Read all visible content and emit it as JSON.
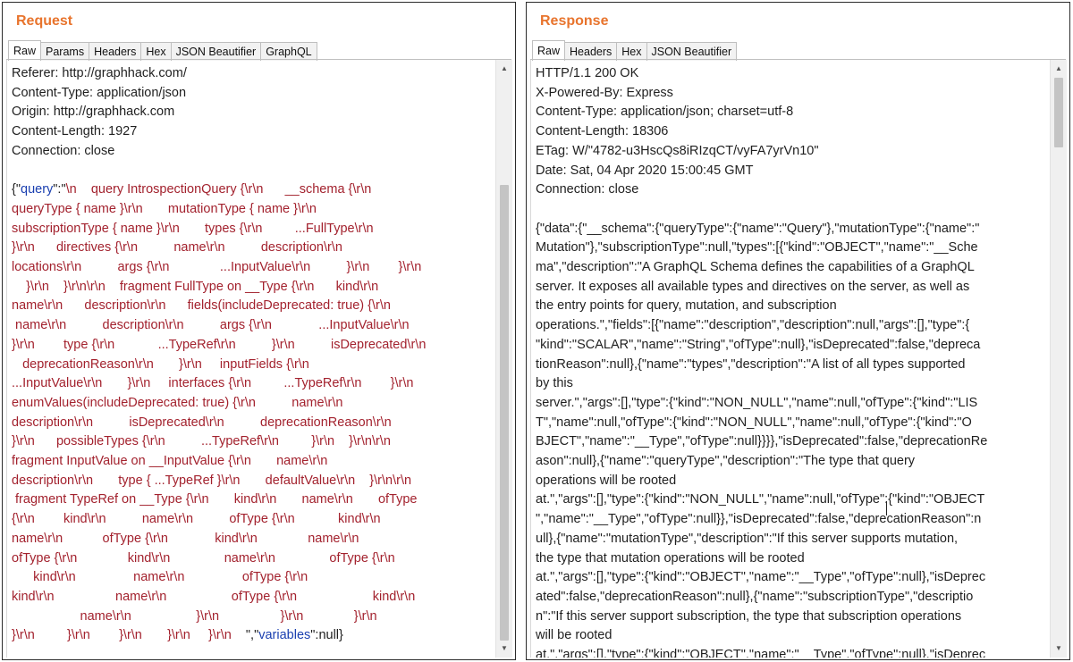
{
  "request": {
    "title": "Request",
    "tabs": [
      "Raw",
      "Params",
      "Headers",
      "Hex",
      "JSON Beautifier",
      "GraphQL"
    ],
    "active_tab": "Raw",
    "headers": [
      "Referer: http://graphhack.com/",
      "Content-Type: application/json",
      "Origin: http://graphhack.com",
      "Content-Length: 1927",
      "Connection: close"
    ],
    "body_lines": [
      [
        [
          "p",
          "{\""
        ],
        [
          "k",
          "query"
        ],
        [
          "p",
          "\":\""
        ],
        [
          "v",
          "\\n    query IntrospectionQuery {\\r\\n      __schema {\\r\\n"
        ]
      ],
      [
        [
          "v",
          "queryType { name }\\r\\n       mutationType { name }\\r\\n"
        ]
      ],
      [
        [
          "v",
          "subscriptionType { name }\\r\\n       types {\\r\\n         ...FullType\\r\\n"
        ]
      ],
      [
        [
          "v",
          "}\\r\\n      directives {\\r\\n          name\\r\\n          description\\r\\n"
        ]
      ],
      [
        [
          "v",
          "locations\\r\\n          args {\\r\\n              ...InputValue\\r\\n          }\\r\\n        }\\r\\n"
        ]
      ],
      [
        [
          "v",
          "    }\\r\\n    }\\r\\n\\r\\n    fragment FullType on __Type {\\r\\n      kind\\r\\n"
        ]
      ],
      [
        [
          "v",
          "name\\r\\n      description\\r\\n      fields(includeDeprecated: true) {\\r\\n"
        ]
      ],
      [
        [
          "v",
          " name\\r\\n          description\\r\\n          args {\\r\\n             ...InputValue\\r\\n"
        ]
      ],
      [
        [
          "v",
          "}\\r\\n        type {\\r\\n            ...TypeRef\\r\\n          }\\r\\n          isDeprecated\\r\\n"
        ]
      ],
      [
        [
          "v",
          "   deprecationReason\\r\\n       }\\r\\n     inputFields {\\r\\n"
        ]
      ],
      [
        [
          "v",
          "...InputValue\\r\\n       }\\r\\n     interfaces {\\r\\n         ...TypeRef\\r\\n        }\\r\\n"
        ]
      ],
      [
        [
          "v",
          "enumValues(includeDeprecated: true) {\\r\\n          name\\r\\n"
        ]
      ],
      [
        [
          "v",
          "description\\r\\n          isDeprecated\\r\\n          deprecationReason\\r\\n"
        ]
      ],
      [
        [
          "v",
          "}\\r\\n      possibleTypes {\\r\\n          ...TypeRef\\r\\n         }\\r\\n    }\\r\\n\\r\\n"
        ]
      ],
      [
        [
          "v",
          "fragment InputValue on __InputValue {\\r\\n       name\\r\\n"
        ]
      ],
      [
        [
          "v",
          "description\\r\\n       type { ...TypeRef }\\r\\n       defaultValue\\r\\n    }\\r\\n\\r\\n"
        ]
      ],
      [
        [
          "v",
          " fragment TypeRef on __Type {\\r\\n       kind\\r\\n       name\\r\\n       ofType"
        ]
      ],
      [
        [
          "v",
          "{\\r\\n        kind\\r\\n          name\\r\\n          ofType {\\r\\n            kind\\r\\n"
        ]
      ],
      [
        [
          "v",
          "name\\r\\n           ofType {\\r\\n             kind\\r\\n              name\\r\\n"
        ]
      ],
      [
        [
          "v",
          "ofType {\\r\\n              kind\\r\\n               name\\r\\n               ofType {\\r\\n"
        ]
      ],
      [
        [
          "v",
          "      kind\\r\\n                name\\r\\n                ofType {\\r\\n"
        ]
      ],
      [
        [
          "v",
          "kind\\r\\n                 name\\r\\n                  ofType {\\r\\n                     kind\\r\\n"
        ]
      ],
      [
        [
          "v",
          "                   name\\r\\n                  }\\r\\n                 }\\r\\n              }\\r\\n"
        ]
      ],
      [
        [
          "v",
          "}\\r\\n         }\\r\\n        }\\r\\n       }\\r\\n     }\\r\\n    "
        ],
        [
          "p",
          "\",\""
        ],
        [
          "k",
          "variables"
        ],
        [
          "p",
          "\":null}"
        ]
      ]
    ]
  },
  "response": {
    "title": "Response",
    "tabs": [
      "Raw",
      "Headers",
      "Hex",
      "JSON Beautifier"
    ],
    "active_tab": "Raw",
    "headers": [
      "HTTP/1.1 200 OK",
      "X-Powered-By: Express",
      "Content-Type: application/json; charset=utf-8",
      "Content-Length: 18306",
      "ETag: W/\"4782-u3HscQs8iRIzqCT/vyFA7yrVn10\"",
      "Date: Sat, 04 Apr 2020 15:00:45 GMT",
      "Connection: close"
    ],
    "body_lines": [
      "{\"data\":{\"__schema\":{\"queryType\":{\"name\":\"Query\"},\"mutationType\":{\"name\":\"",
      "Mutation\"},\"subscriptionType\":null,\"types\":[{\"kind\":\"OBJECT\",\"name\":\"__Sche",
      "ma\",\"description\":\"A GraphQL Schema defines the capabilities of a GraphQL",
      "server. It exposes all available types and directives on the server, as well as",
      "the entry points for query, mutation, and subscription",
      "operations.\",\"fields\":[{\"name\":\"description\",\"description\":null,\"args\":[],\"type\":{",
      "\"kind\":\"SCALAR\",\"name\":\"String\",\"ofType\":null},\"isDeprecated\":false,\"depreca",
      "tionReason\":null},{\"name\":\"types\",\"description\":\"A list of all types supported",
      "by this",
      "server.\",\"args\":[],\"type\":{\"kind\":\"NON_NULL\",\"name\":null,\"ofType\":{\"kind\":\"LIS",
      "T\",\"name\":null,\"ofType\":{\"kind\":\"NON_NULL\",\"name\":null,\"ofType\":{\"kind\":\"O",
      "BJECT\",\"name\":\"__Type\",\"ofType\":null}}}},\"isDeprecated\":false,\"deprecationRe",
      "ason\":null},{\"name\":\"queryType\",\"description\":\"The type that query",
      "operations will be rooted",
      "at.\",\"args\":[],\"type\":{\"kind\":\"NON_NULL\",\"name\":null,\"ofType\":{\"kind\":\"OBJECT",
      "\",\"name\":\"__Type\",\"ofType\":null}},\"isDeprecated\":false,\"deprecationReason\":n",
      "ull},{\"name\":\"mutationType\",\"description\":\"If this server supports mutation,",
      "the type that mutation operations will be rooted",
      "at.\",\"args\":[],\"type\":{\"kind\":\"OBJECT\",\"name\":\"__Type\",\"ofType\":null},\"isDeprec",
      "ated\":false,\"deprecationReason\":null},{\"name\":\"subscriptionType\",\"descriptio",
      "n\":\"If this server support subscription, the type that subscription operations",
      "will be rooted",
      "at.\",\"args\":[],\"type\":{\"kind\":\"OBJECT\",\"name\":\"__Type\",\"ofType\":null},\"isDeprec"
    ]
  }
}
